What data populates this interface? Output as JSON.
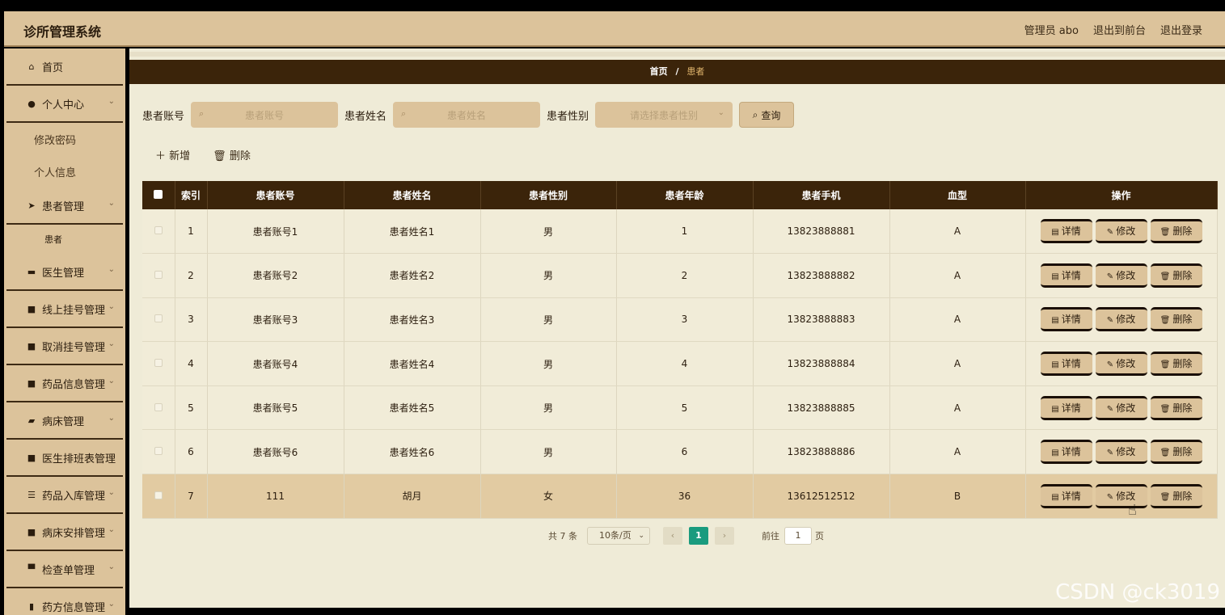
{
  "header": {
    "title": "诊所管理系统",
    "admin": "管理员 abo",
    "exit_front": "退出到前台",
    "logout": "退出登录"
  },
  "sidebar": {
    "home": "首页",
    "personal": "个人中心",
    "change_password": "修改密码",
    "personal_info": "个人信息",
    "patient_mgmt": "患者管理",
    "patient_sub": "患者",
    "doctor_mgmt": "医生管理",
    "online_reg": "线上挂号管理",
    "cancel_reg": "取消挂号管理",
    "drug_info": "药品信息管理",
    "bed_mgmt": "病床管理",
    "schedule": "医生排班表管理",
    "drug_stock": "药品入库管理",
    "bed_arrange": "病床安排管理",
    "exam_order": "检查单管理",
    "prescription": "药方信息管理"
  },
  "breadcrumb": {
    "home": "首页",
    "sep": "/",
    "current": "患者"
  },
  "search": {
    "account_label": "患者账号",
    "account_placeholder": "患者账号",
    "name_label": "患者姓名",
    "name_placeholder": "患者姓名",
    "gender_label": "患者性别",
    "gender_placeholder": "请选择患者性别",
    "query": "查询"
  },
  "actions": {
    "add": "新增",
    "delete": "删除"
  },
  "table": {
    "headers": [
      "索引",
      "患者账号",
      "患者姓名",
      "患者性别",
      "患者年龄",
      "患者手机",
      "血型",
      "操作"
    ],
    "rows": [
      {
        "index": "1",
        "account": "患者账号1",
        "name": "患者姓名1",
        "gender": "男",
        "age": "1",
        "phone": "13823888881",
        "blood": "A"
      },
      {
        "index": "2",
        "account": "患者账号2",
        "name": "患者姓名2",
        "gender": "男",
        "age": "2",
        "phone": "13823888882",
        "blood": "A"
      },
      {
        "index": "3",
        "account": "患者账号3",
        "name": "患者姓名3",
        "gender": "男",
        "age": "3",
        "phone": "13823888883",
        "blood": "A"
      },
      {
        "index": "4",
        "account": "患者账号4",
        "name": "患者姓名4",
        "gender": "男",
        "age": "4",
        "phone": "13823888884",
        "blood": "A"
      },
      {
        "index": "5",
        "account": "患者账号5",
        "name": "患者姓名5",
        "gender": "男",
        "age": "5",
        "phone": "13823888885",
        "blood": "A"
      },
      {
        "index": "6",
        "account": "患者账号6",
        "name": "患者姓名6",
        "gender": "男",
        "age": "6",
        "phone": "13823888886",
        "blood": "A"
      },
      {
        "index": "7",
        "account": "111",
        "name": "胡月",
        "gender": "女",
        "age": "36",
        "phone": "13612512512",
        "blood": "B"
      }
    ],
    "btn_detail": "详情",
    "btn_edit": "修改",
    "btn_delete": "删除"
  },
  "pager": {
    "total": "共 7 条",
    "size": "10条/页",
    "prev": "‹",
    "page": "1",
    "next": "›",
    "goto": "前往",
    "goto_value": "1",
    "page_unit": "页"
  },
  "watermark": "CSDN @ck3019"
}
